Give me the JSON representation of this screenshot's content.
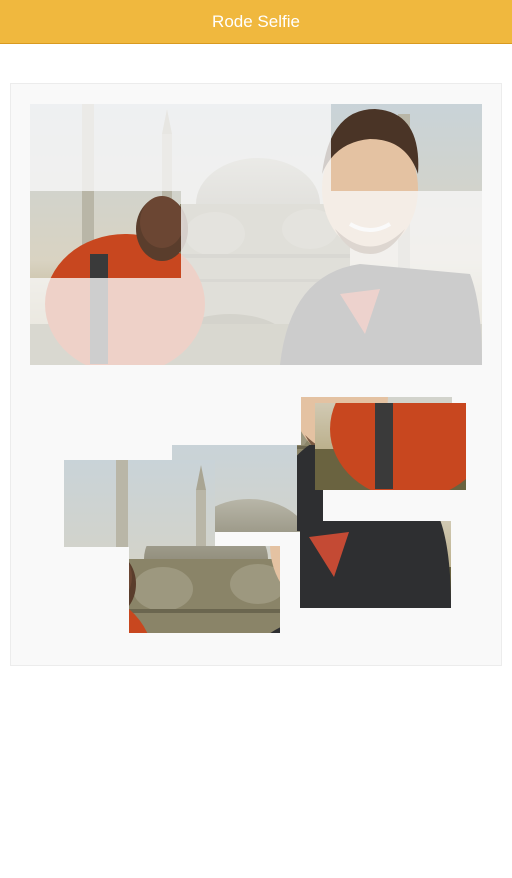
{
  "header": {
    "title": "Rode Selfie"
  },
  "colors": {
    "header_bg": "#f0b83e",
    "board_bg": "#f9f9f9",
    "text": "#ffffff"
  },
  "puzzle": {
    "grid": {
      "rows": 3,
      "cols": 3
    },
    "placed_pieces": [
      "piece-row1-col3",
      "piece-row2-col1"
    ],
    "loose_piece_count": 7
  }
}
